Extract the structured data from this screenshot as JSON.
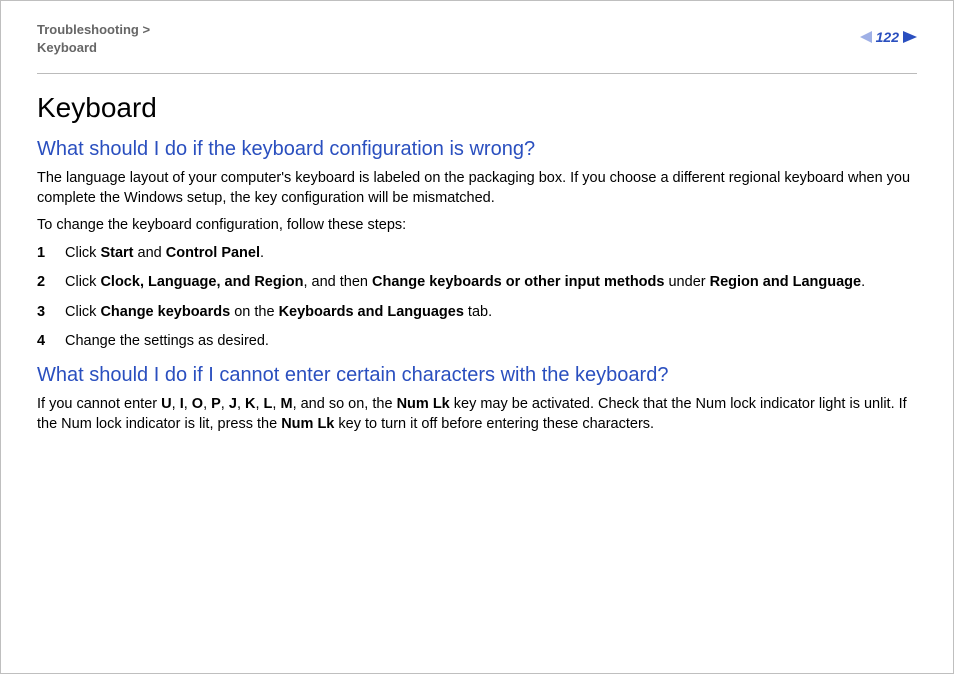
{
  "breadcrumb": {
    "parent": "Troubleshooting",
    "sep": ">",
    "child": "Keyboard"
  },
  "page_number": "122",
  "title": "Keyboard",
  "section1": {
    "heading": "What should I do if the keyboard configuration is wrong?",
    "para1": "The language layout of your computer's keyboard is labeled on the packaging box. If you choose a different regional keyboard when you complete the Windows setup, the key configuration will be mismatched.",
    "para2": "To change the keyboard configuration, follow these steps:",
    "step1": {
      "t1": "Click ",
      "b1": "Start",
      "t2": " and ",
      "b2": "Control Panel",
      "t3": "."
    },
    "step2": {
      "t1": "Click ",
      "b1": "Clock, Language, and Region",
      "t2": ", and then ",
      "b2": "Change keyboards or other input methods",
      "t3": " under ",
      "b3": "Region and Language",
      "t4": "."
    },
    "step3": {
      "t1": "Click ",
      "b1": "Change keyboards",
      "t2": " on the ",
      "b2": "Keyboards and Languages",
      "t3": " tab."
    },
    "step4": {
      "t1": "Change the settings as desired."
    }
  },
  "section2": {
    "heading": "What should I do if I cannot enter certain characters with the keyboard?",
    "para": {
      "t1": "If you cannot enter ",
      "b1": "U",
      "c1": ", ",
      "b2": "I",
      "c2": ", ",
      "b3": "O",
      "c3": ", ",
      "b4": "P",
      "c4": ", ",
      "b5": "J",
      "c5": ", ",
      "b6": "K",
      "c6": ", ",
      "b7": "L",
      "c7": ", ",
      "b8": "M",
      "t2": ", and so on, the ",
      "b9": "Num Lk",
      "t3": " key may be activated. Check that the Num lock indicator light is unlit. If the Num lock indicator is lit, press the ",
      "b10": "Num Lk",
      "t4": " key to turn it off before entering these characters."
    }
  }
}
